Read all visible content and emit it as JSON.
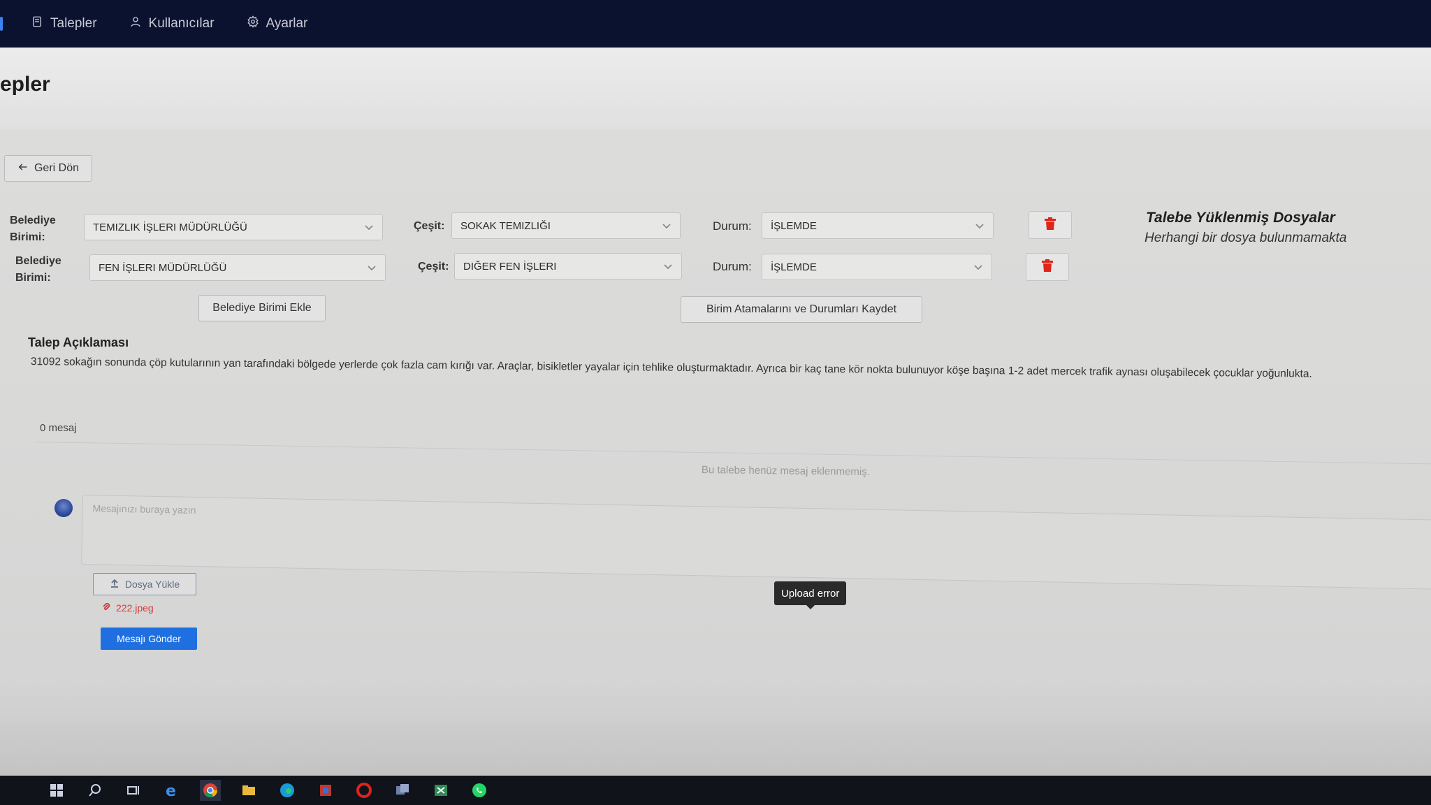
{
  "nav": {
    "items": [
      {
        "label": "Talepler",
        "icon": "document-icon"
      },
      {
        "label": "Kullanıcılar",
        "icon": "user-icon"
      },
      {
        "label": "Ayarlar",
        "icon": "gear-icon"
      }
    ]
  },
  "page": {
    "title": "epler",
    "back_label": "Geri Dön"
  },
  "assignments": [
    {
      "unit_label": "Belediye Birimi:",
      "unit_value": "TEMIZLIK İŞLERI MÜDÜRLÜĞÜ",
      "type_label": "Çeşit:",
      "type_value": "SOKAK TEMIZLIĞI",
      "status_label": "Durum:",
      "status_value": "İŞLEMDE"
    },
    {
      "unit_label": "Belediye Birimi:",
      "unit_value": "FEN İŞLERI MÜDÜRLÜĞÜ",
      "type_label": "Çeşit:",
      "type_value": "DIĞER FEN İŞLERI",
      "status_label": "Durum:",
      "status_value": "İŞLEMDE"
    }
  ],
  "buttons": {
    "add_unit": "Belediye Birimi Ekle",
    "save_assignments": "Birim Atamalarını ve Durumları Kaydet",
    "upload": "Dosya Yükle",
    "send": "Mesajı Gönder"
  },
  "files": {
    "title": "Talebe Yüklenmiş Dosyalar",
    "empty_text": "Herhangi bir dosya bulunmamakta"
  },
  "description": {
    "title": "Talep Açıklaması",
    "text": "31092 sokağın sonunda çöp kutularının yan tarafındaki bölgede yerlerde çok fazla cam kırığı var. Araçlar, bisikletler yayalar için tehlike oluşturmaktadır. Ayrıca bir kaç tane kör nokta bulunuyor köşe başına 1-2 adet mercek trafik aynası oluşabilecek çocuklar yoğunlukta."
  },
  "messages": {
    "count_text": "0 mesaj",
    "empty_text": "Bu talebe henüz mesaj eklenmemiş.",
    "input_placeholder": "Mesajınızı buraya yazın",
    "attached_file": "222.jpeg",
    "tooltip": "Upload error"
  },
  "colors": {
    "nav_bg": "#0b1230",
    "primary": "#1f6fe0",
    "danger": "#e0231b"
  }
}
